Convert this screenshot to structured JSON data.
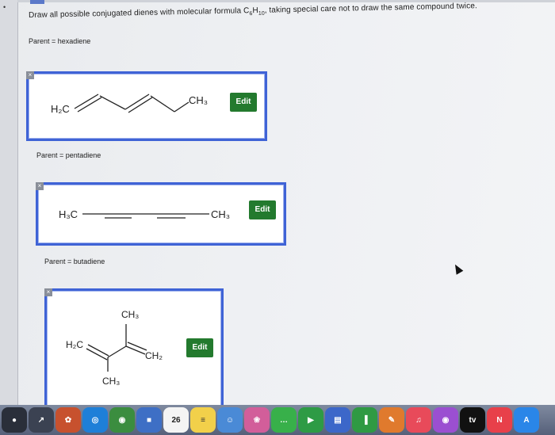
{
  "question": {
    "prefix": "Draw all possible conjugated dienes with molecular formula C",
    "c_sub": "6",
    "h": "H",
    "h_sub": "10",
    "suffix": ", taking special care not to draw the same compound twice."
  },
  "sections": [
    {
      "parent_label": "Parent = hexadiene",
      "left_group": "H₂C",
      "right_group": "CH₃",
      "edit_label": "Edit"
    },
    {
      "parent_label": "Parent = pentadiene",
      "left_group": "H₃C",
      "right_group": "CH₃",
      "edit_label": "Edit"
    },
    {
      "parent_label": "Parent = butadiene",
      "left_group": "H₂C",
      "right_group": "CH₂",
      "top_group": "CH₃",
      "bottom_group": "CH₃",
      "edit_label": "Edit"
    }
  ],
  "close_glyph": "×",
  "dock": {
    "items": [
      {
        "icon": "launchpad-icon",
        "color": "#2a2f3a",
        "glyph": "●"
      },
      {
        "icon": "rocket-icon",
        "color": "#3b4252",
        "glyph": "↗"
      },
      {
        "icon": "photos-icon",
        "color": "#c7512e",
        "glyph": "✿"
      },
      {
        "icon": "safari-icon",
        "color": "#1e7fd8",
        "glyph": "◎"
      },
      {
        "icon": "chrome-icon",
        "color": "#3b8d3f",
        "glyph": "◉"
      },
      {
        "icon": "folder-icon",
        "color": "#3e6fc5",
        "glyph": "■"
      },
      {
        "icon": "calendar-icon",
        "color": "#f4f4f4",
        "glyph": "26",
        "text_color": "#222"
      },
      {
        "icon": "notes-icon",
        "color": "#f2d04a",
        "glyph": "≡",
        "text_color": "#333"
      },
      {
        "icon": "finder-icon",
        "color": "#4a8ad6",
        "glyph": "☺"
      },
      {
        "icon": "photos-app-icon",
        "color": "#d25e9a",
        "glyph": "❀"
      },
      {
        "icon": "messages-icon",
        "color": "#38b04a",
        "glyph": "…"
      },
      {
        "icon": "facetime-icon",
        "color": "#2e9b45",
        "glyph": "▶"
      },
      {
        "icon": "keynote-icon",
        "color": "#3c67c9",
        "glyph": "▤"
      },
      {
        "icon": "numbers-icon",
        "color": "#2f9a43",
        "glyph": "▐"
      },
      {
        "icon": "pages-icon",
        "color": "#e07a2d",
        "glyph": "✎"
      },
      {
        "icon": "music-icon",
        "color": "#e84a5a",
        "glyph": "♫"
      },
      {
        "icon": "podcasts-icon",
        "color": "#9b4fd1",
        "glyph": "◉"
      },
      {
        "icon": "tv-icon",
        "color": "#111111",
        "glyph": "tv"
      },
      {
        "icon": "news-icon",
        "color": "#e8404a",
        "glyph": "N"
      },
      {
        "icon": "app-store-icon",
        "color": "#2a86e8",
        "glyph": "A"
      }
    ]
  }
}
